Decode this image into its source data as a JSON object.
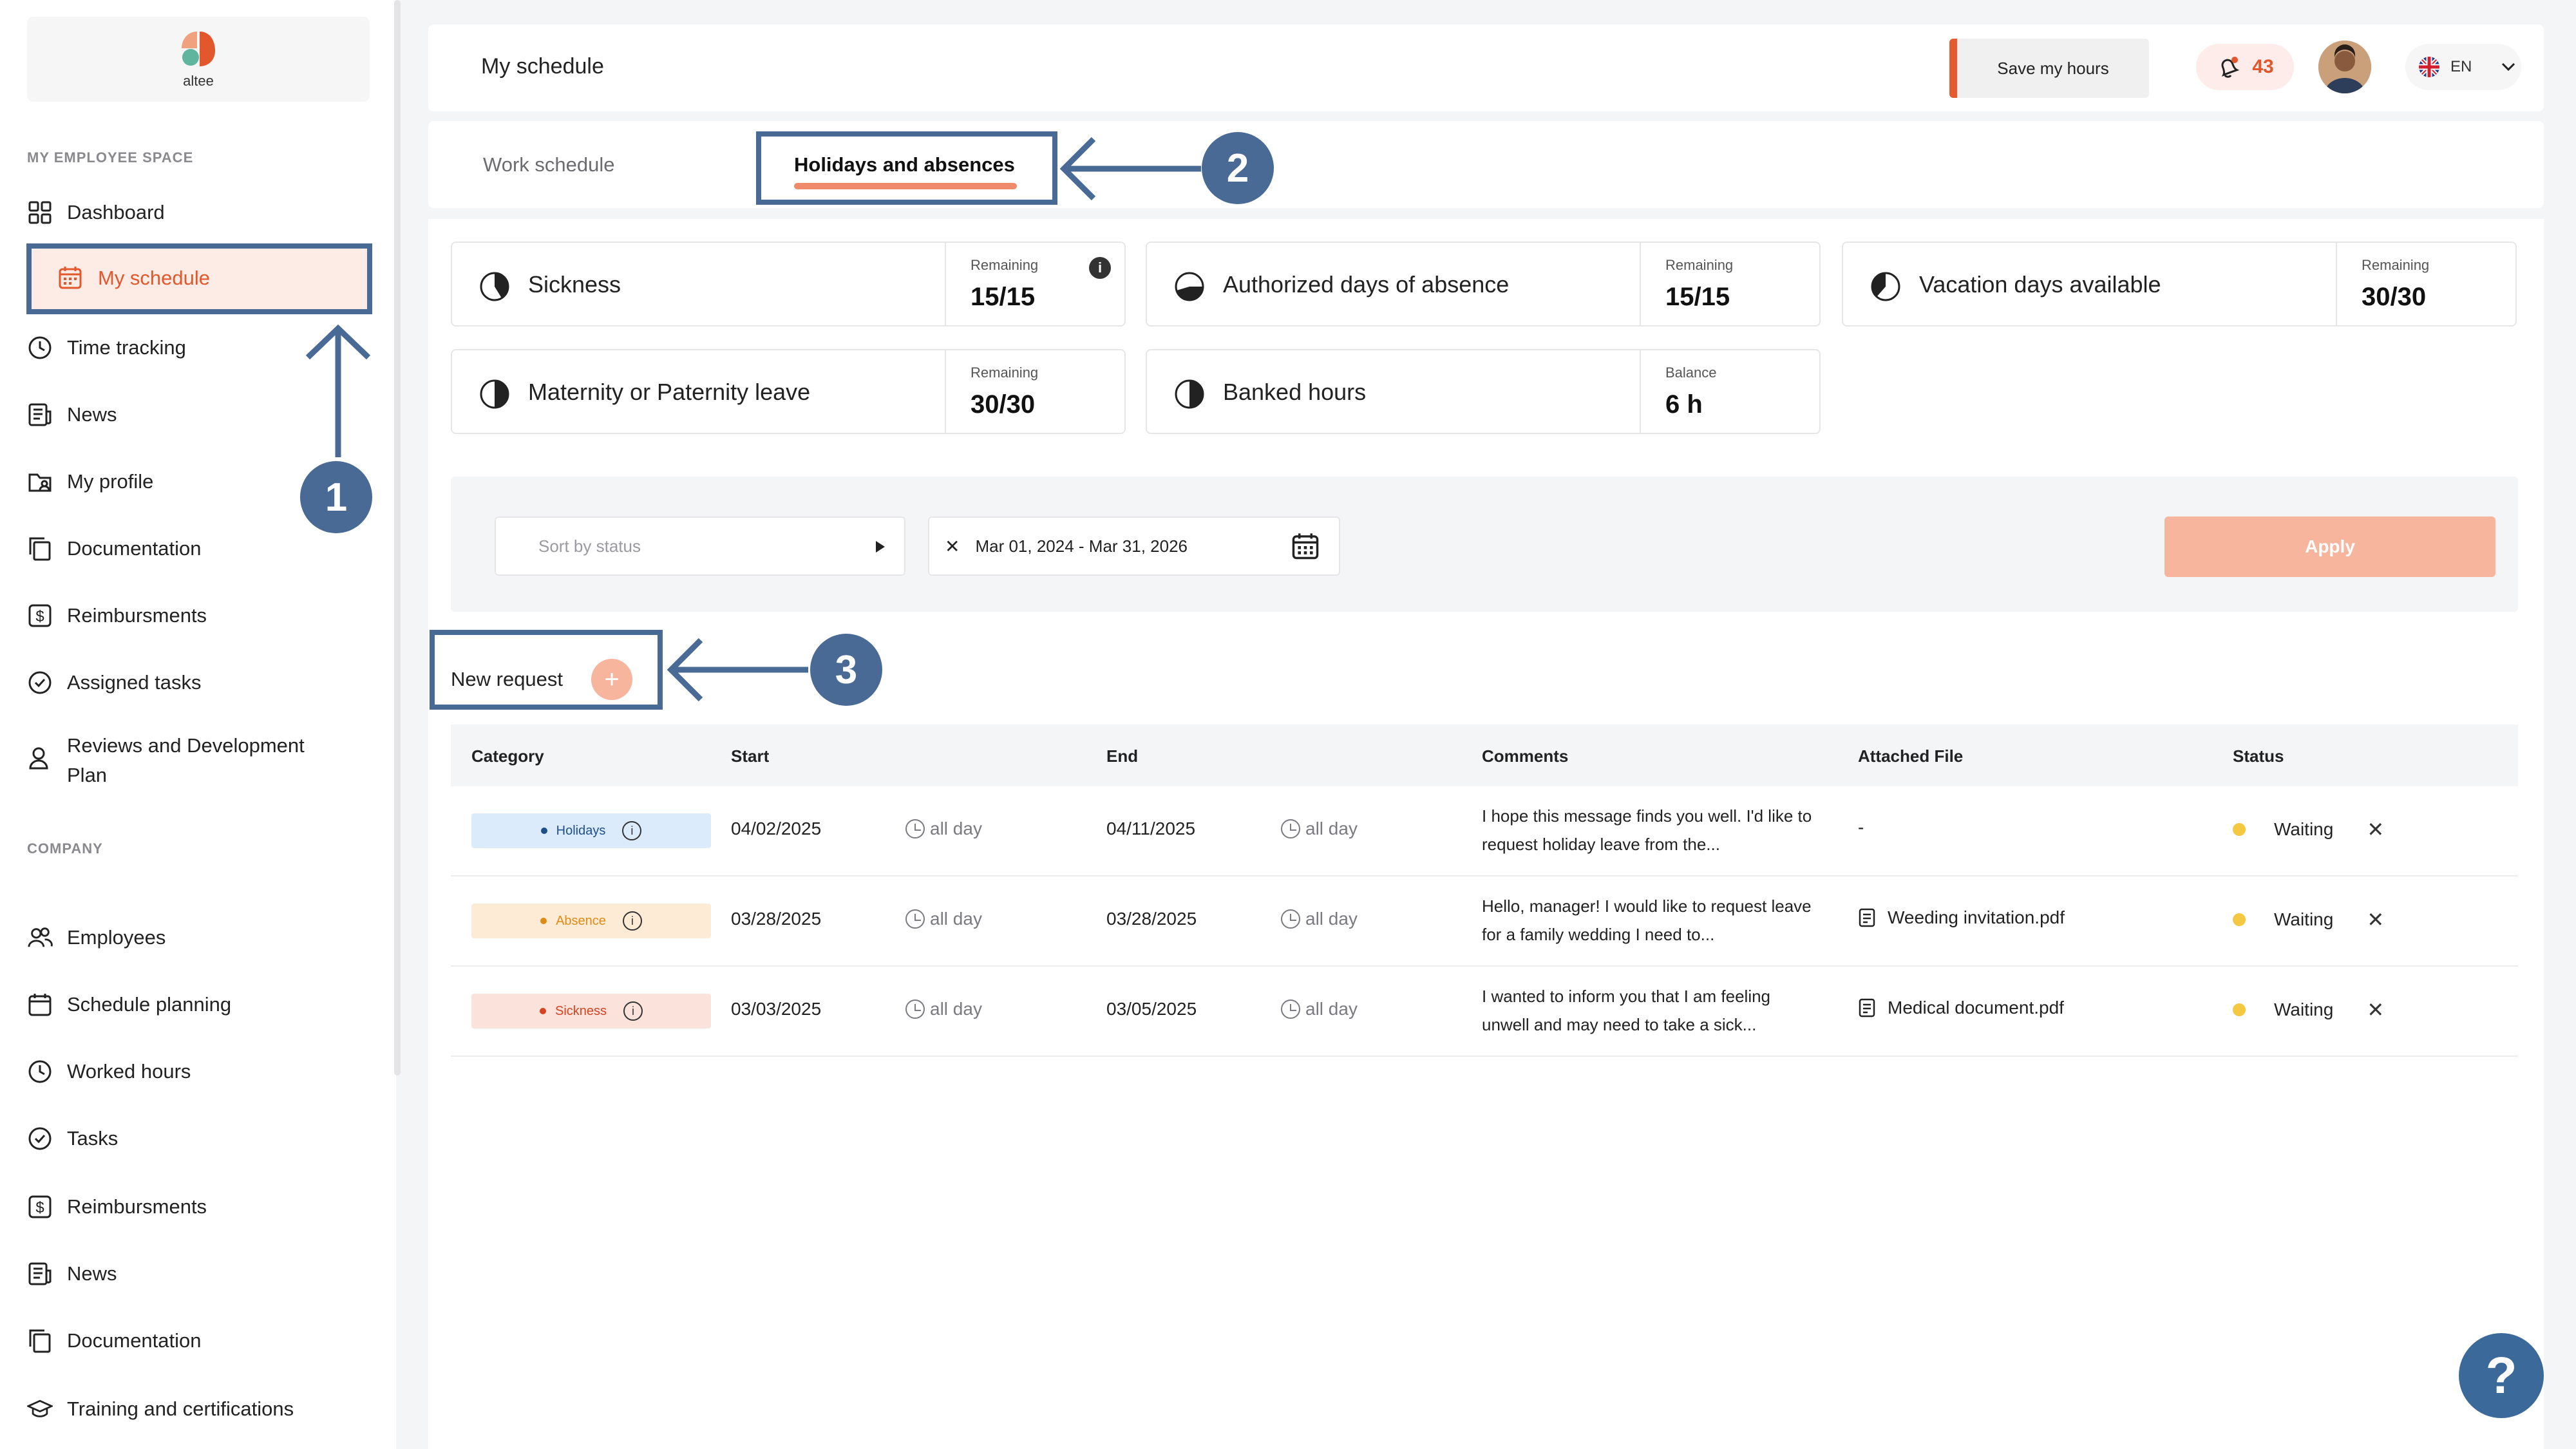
{
  "app": {
    "logo_text": "altee"
  },
  "sidebar": {
    "section_employee": "MY EMPLOYEE SPACE",
    "section_company": "COMPANY",
    "employee_items": [
      {
        "label": "Dashboard",
        "icon": "dashboard-icon"
      },
      {
        "label": "My schedule",
        "icon": "calendar-icon",
        "active": true
      },
      {
        "label": "Time tracking",
        "icon": "clock-icon"
      },
      {
        "label": "News",
        "icon": "news-icon"
      },
      {
        "label": "My profile",
        "icon": "profile-folder-icon"
      },
      {
        "label": "Documentation",
        "icon": "documents-icon"
      },
      {
        "label": "Reimbursments",
        "icon": "dollar-icon"
      },
      {
        "label": "Assigned tasks",
        "icon": "check-circle-icon"
      },
      {
        "label": "Reviews and Development Plan",
        "icon": "person-icon"
      }
    ],
    "company_items": [
      {
        "label": "Employees",
        "icon": "people-icon"
      },
      {
        "label": "Schedule planning",
        "icon": "calendar-icon"
      },
      {
        "label": "Worked hours",
        "icon": "clock-icon"
      },
      {
        "label": "Tasks",
        "icon": "check-circle-icon"
      },
      {
        "label": "Reimbursments",
        "icon": "dollar-icon"
      },
      {
        "label": "News",
        "icon": "news-icon"
      },
      {
        "label": "Documentation",
        "icon": "documents-icon"
      },
      {
        "label": "Training and certifications",
        "icon": "graduation-cap-icon"
      }
    ]
  },
  "header": {
    "title": "My schedule",
    "save_label": "Save my hours",
    "notifications_count": "43",
    "language": "EN"
  },
  "tabs": [
    {
      "label": "Work schedule",
      "active": false
    },
    {
      "label": "Holidays and absences",
      "active": true
    }
  ],
  "balances": [
    {
      "name": "Sickness",
      "sub": "Remaining",
      "value": "15/15",
      "info": true
    },
    {
      "name": "Authorized days of absence",
      "sub": "Remaining",
      "value": "15/15"
    },
    {
      "name": "Vacation days available",
      "sub": "Remaining",
      "value": "30/30"
    },
    {
      "name": "Maternity or Paternity leave",
      "sub": "Remaining",
      "value": "30/30"
    },
    {
      "name": "Banked hours",
      "sub": "Balance",
      "value": "6 h"
    }
  ],
  "filters": {
    "sort_placeholder": "Sort by status",
    "date_range": "Mar 01, 2024 - Mar 31, 2026",
    "apply_label": "Apply"
  },
  "new_request_label": "New request",
  "table": {
    "headers": [
      "Category",
      "Start",
      "End",
      "Comments",
      "Attached File",
      "Status"
    ],
    "rows": [
      {
        "category": "Holidays",
        "start": "04/02/2025",
        "start_time": "all day",
        "end": "04/11/2025",
        "end_time": "all day",
        "comment": "I hope this message finds you well. I'd like to request holiday leave from the...",
        "file": "-",
        "status": "Waiting"
      },
      {
        "category": "Absence",
        "start": "03/28/2025",
        "start_time": "all day",
        "end": "03/28/2025",
        "end_time": "all day",
        "comment": "Hello, manager! I would like to request leave for a family wedding I need to...",
        "file": "Weeding invitation.pdf",
        "status": "Waiting"
      },
      {
        "category": "Sickness",
        "start": "03/03/2025",
        "start_time": "all day",
        "end": "03/05/2025",
        "end_time": "all day",
        "comment": "I wanted to inform you that I am feeling unwell and may need to take a sick...",
        "file": "Medical document.pdf",
        "status": "Waiting"
      }
    ]
  },
  "annotations": [
    "1",
    "2",
    "3"
  ],
  "help_label": "?",
  "colors": {
    "accent": "#e2572b",
    "annotation": "#4a6a96",
    "holidays_badge": "#dcebfb",
    "absence_badge": "#fdebd6",
    "sickness_badge": "#fbe3dc",
    "waiting": "#f5c842"
  }
}
